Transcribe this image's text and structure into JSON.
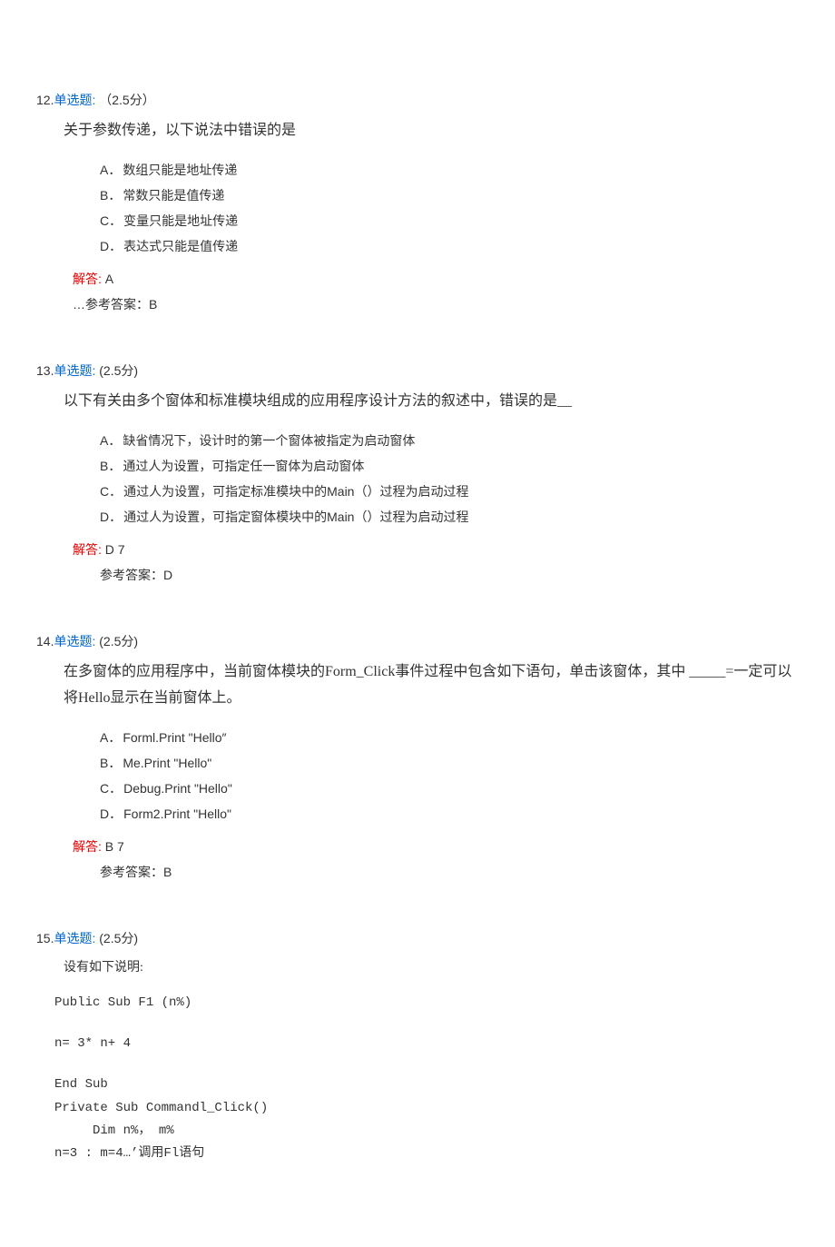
{
  "q12": {
    "number": "12.",
    "type": "单选题:",
    "points": "（2.5分）",
    "stem": "关于参数传递，以下说法中错误的是",
    "options": [
      {
        "letter": "A．",
        "text": "数组只能是地址传递"
      },
      {
        "letter": "B．",
        "text": "常数只能是值传递"
      },
      {
        "letter": "C．",
        "text": "变量只能是地址传递"
      },
      {
        "letter": "D．",
        "text": "表达式只能是值传递"
      }
    ],
    "solution_label": "解答:",
    "solution_value": "A",
    "ref_prefix": "…参考答案：",
    "ref_value": "B"
  },
  "q13": {
    "number": "13.",
    "type": "单选题:",
    "points": "(2.5分)",
    "stem": "以下有关由多个窗体和标准模块组成的应用程序设计方法的叙述中，错误的是__",
    "options": [
      {
        "letter": "A．",
        "text": "缺省情况下，设计时的第一个窗体被指定为启动窗体"
      },
      {
        "letter": "B．",
        "text": "通过人为设置，可指定任一窗体为启动窗体"
      },
      {
        "letter": "C．",
        "text": "通过人为设置，可指定标准模块中的Main（）过程为启动过程"
      },
      {
        "letter": "D．",
        "text": "通过人为设置，可指定窗体模块中的Main（）过程为启动过程"
      }
    ],
    "solution_label": "解答:",
    "solution_value": "D 7",
    "ref_prefix": "参考答案：",
    "ref_value": "D"
  },
  "q14": {
    "number": "14.",
    "type": "单选题:",
    "points": "(2.5分)",
    "stem": "在多窗体的应用程序中，当前窗体模块的Form_Click事件过程中包含如下语句，单击该窗体，其中 _____=一定可以将Hello显示在当前窗体上。",
    "options": [
      {
        "letter": "A．",
        "text": "Forml.Print \"Hello″"
      },
      {
        "letter": "B．",
        "text": "Me.Print \"Hello\""
      },
      {
        "letter": "C．",
        "text": "Debug.Print \"Hello\""
      },
      {
        "letter": "D．",
        "text": "Form2.Print \"Hello\""
      }
    ],
    "solution_label": "解答:",
    "solution_value": "B 7",
    "ref_prefix": "参考答案：",
    "ref_value": "B"
  },
  "q15": {
    "number": "15.",
    "type": "单选题:",
    "points": "(2.5分)",
    "stem": "设有如下说明:",
    "code": [
      "Public Sub F1 (n%)",
      "",
      "n= 3* n+ 4",
      "",
      "End Sub",
      "Private Sub Commandl_Click()",
      "     Dim n%， m%",
      "n=3 : m=4…’调用Fl语句"
    ]
  }
}
